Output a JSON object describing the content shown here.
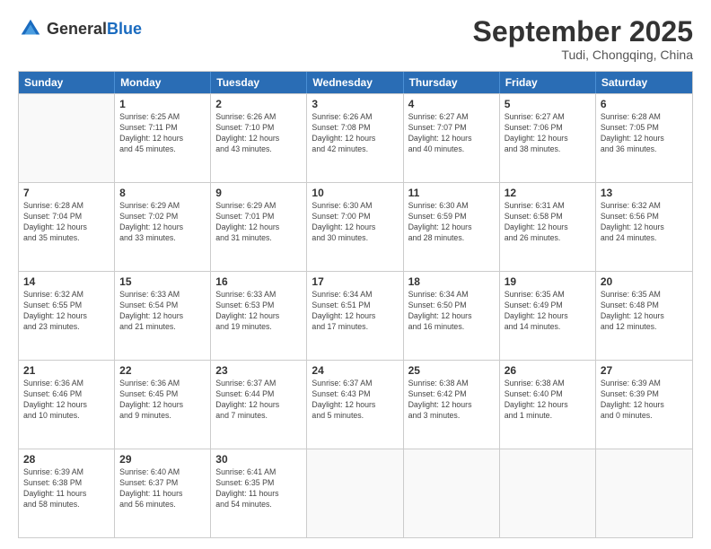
{
  "header": {
    "logo": {
      "general": "General",
      "blue": "Blue"
    },
    "month": "September 2025",
    "location": "Tudi, Chongqing, China"
  },
  "weekdays": [
    "Sunday",
    "Monday",
    "Tuesday",
    "Wednesday",
    "Thursday",
    "Friday",
    "Saturday"
  ],
  "weeks": [
    [
      {
        "day": "",
        "info": ""
      },
      {
        "day": "1",
        "info": "Sunrise: 6:25 AM\nSunset: 7:11 PM\nDaylight: 12 hours\nand 45 minutes."
      },
      {
        "day": "2",
        "info": "Sunrise: 6:26 AM\nSunset: 7:10 PM\nDaylight: 12 hours\nand 43 minutes."
      },
      {
        "day": "3",
        "info": "Sunrise: 6:26 AM\nSunset: 7:08 PM\nDaylight: 12 hours\nand 42 minutes."
      },
      {
        "day": "4",
        "info": "Sunrise: 6:27 AM\nSunset: 7:07 PM\nDaylight: 12 hours\nand 40 minutes."
      },
      {
        "day": "5",
        "info": "Sunrise: 6:27 AM\nSunset: 7:06 PM\nDaylight: 12 hours\nand 38 minutes."
      },
      {
        "day": "6",
        "info": "Sunrise: 6:28 AM\nSunset: 7:05 PM\nDaylight: 12 hours\nand 36 minutes."
      }
    ],
    [
      {
        "day": "7",
        "info": "Sunrise: 6:28 AM\nSunset: 7:04 PM\nDaylight: 12 hours\nand 35 minutes."
      },
      {
        "day": "8",
        "info": "Sunrise: 6:29 AM\nSunset: 7:02 PM\nDaylight: 12 hours\nand 33 minutes."
      },
      {
        "day": "9",
        "info": "Sunrise: 6:29 AM\nSunset: 7:01 PM\nDaylight: 12 hours\nand 31 minutes."
      },
      {
        "day": "10",
        "info": "Sunrise: 6:30 AM\nSunset: 7:00 PM\nDaylight: 12 hours\nand 30 minutes."
      },
      {
        "day": "11",
        "info": "Sunrise: 6:30 AM\nSunset: 6:59 PM\nDaylight: 12 hours\nand 28 minutes."
      },
      {
        "day": "12",
        "info": "Sunrise: 6:31 AM\nSunset: 6:58 PM\nDaylight: 12 hours\nand 26 minutes."
      },
      {
        "day": "13",
        "info": "Sunrise: 6:32 AM\nSunset: 6:56 PM\nDaylight: 12 hours\nand 24 minutes."
      }
    ],
    [
      {
        "day": "14",
        "info": "Sunrise: 6:32 AM\nSunset: 6:55 PM\nDaylight: 12 hours\nand 23 minutes."
      },
      {
        "day": "15",
        "info": "Sunrise: 6:33 AM\nSunset: 6:54 PM\nDaylight: 12 hours\nand 21 minutes."
      },
      {
        "day": "16",
        "info": "Sunrise: 6:33 AM\nSunset: 6:53 PM\nDaylight: 12 hours\nand 19 minutes."
      },
      {
        "day": "17",
        "info": "Sunrise: 6:34 AM\nSunset: 6:51 PM\nDaylight: 12 hours\nand 17 minutes."
      },
      {
        "day": "18",
        "info": "Sunrise: 6:34 AM\nSunset: 6:50 PM\nDaylight: 12 hours\nand 16 minutes."
      },
      {
        "day": "19",
        "info": "Sunrise: 6:35 AM\nSunset: 6:49 PM\nDaylight: 12 hours\nand 14 minutes."
      },
      {
        "day": "20",
        "info": "Sunrise: 6:35 AM\nSunset: 6:48 PM\nDaylight: 12 hours\nand 12 minutes."
      }
    ],
    [
      {
        "day": "21",
        "info": "Sunrise: 6:36 AM\nSunset: 6:46 PM\nDaylight: 12 hours\nand 10 minutes."
      },
      {
        "day": "22",
        "info": "Sunrise: 6:36 AM\nSunset: 6:45 PM\nDaylight: 12 hours\nand 9 minutes."
      },
      {
        "day": "23",
        "info": "Sunrise: 6:37 AM\nSunset: 6:44 PM\nDaylight: 12 hours\nand 7 minutes."
      },
      {
        "day": "24",
        "info": "Sunrise: 6:37 AM\nSunset: 6:43 PM\nDaylight: 12 hours\nand 5 minutes."
      },
      {
        "day": "25",
        "info": "Sunrise: 6:38 AM\nSunset: 6:42 PM\nDaylight: 12 hours\nand 3 minutes."
      },
      {
        "day": "26",
        "info": "Sunrise: 6:38 AM\nSunset: 6:40 PM\nDaylight: 12 hours\nand 1 minute."
      },
      {
        "day": "27",
        "info": "Sunrise: 6:39 AM\nSunset: 6:39 PM\nDaylight: 12 hours\nand 0 minutes."
      }
    ],
    [
      {
        "day": "28",
        "info": "Sunrise: 6:39 AM\nSunset: 6:38 PM\nDaylight: 11 hours\nand 58 minutes."
      },
      {
        "day": "29",
        "info": "Sunrise: 6:40 AM\nSunset: 6:37 PM\nDaylight: 11 hours\nand 56 minutes."
      },
      {
        "day": "30",
        "info": "Sunrise: 6:41 AM\nSunset: 6:35 PM\nDaylight: 11 hours\nand 54 minutes."
      },
      {
        "day": "",
        "info": ""
      },
      {
        "day": "",
        "info": ""
      },
      {
        "day": "",
        "info": ""
      },
      {
        "day": "",
        "info": ""
      }
    ]
  ]
}
